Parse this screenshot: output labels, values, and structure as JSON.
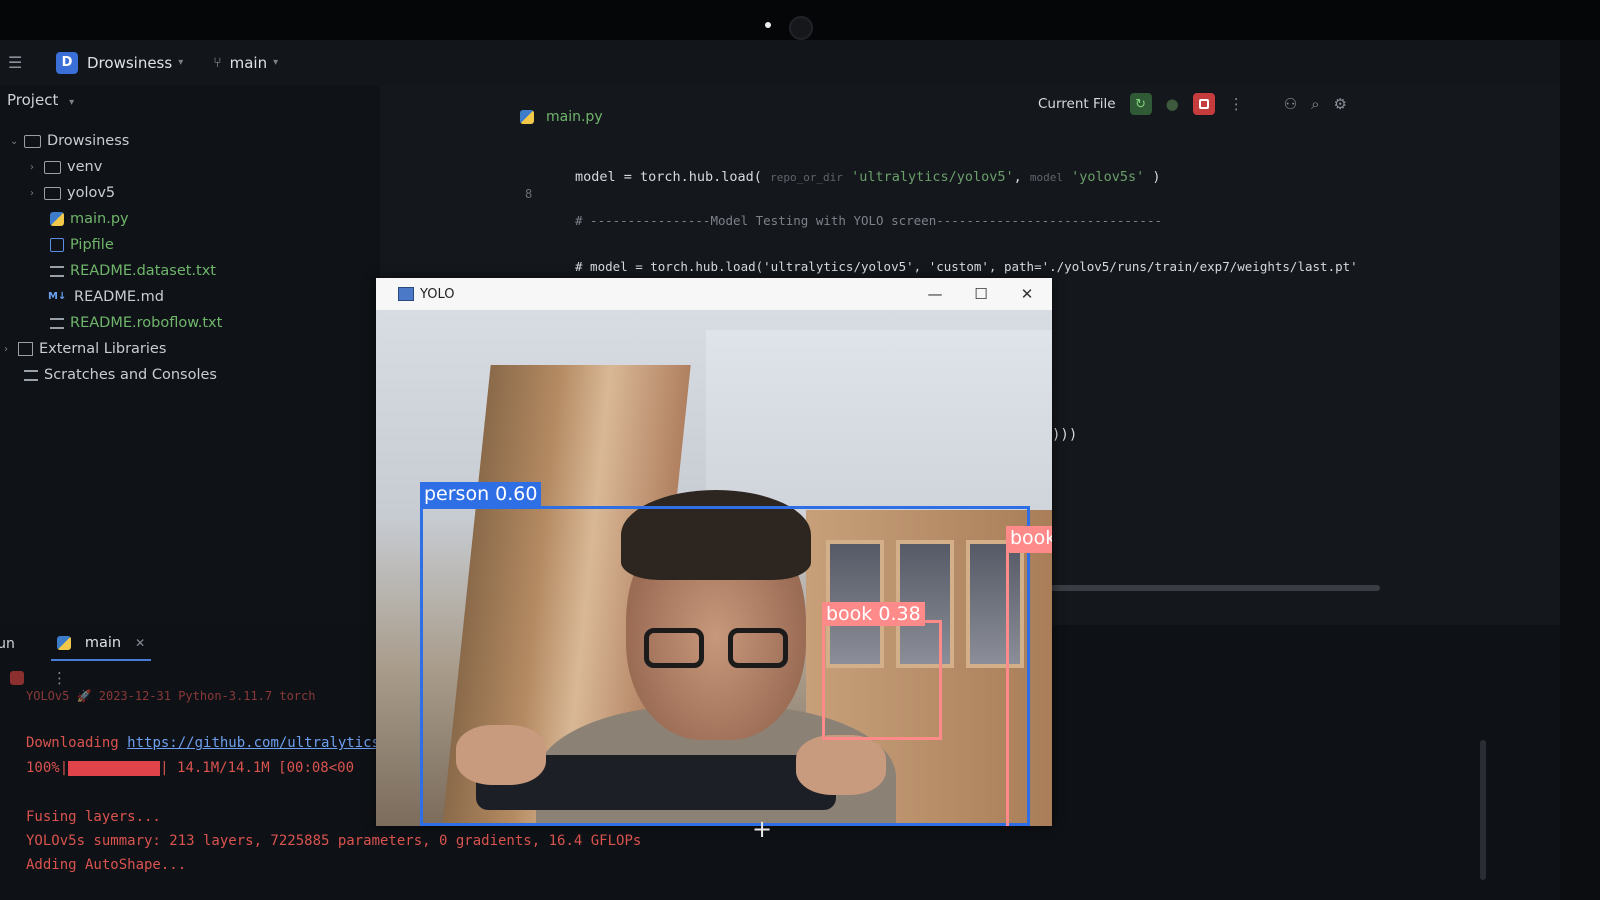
{
  "topbar": {
    "project_initial": "D",
    "project_name": "Drowsiness",
    "branch": "main"
  },
  "sidebar": {
    "header": "Project",
    "items": [
      {
        "label": "Drowsiness"
      },
      {
        "label": "venv"
      },
      {
        "label": "yolov5"
      },
      {
        "label": "main.py"
      },
      {
        "label": "Pipfile"
      },
      {
        "label": "README.dataset.txt"
      },
      {
        "label": "README.md"
      },
      {
        "label": "README.roboflow.txt"
      },
      {
        "label": "External Libraries"
      },
      {
        "label": "Scratches and Consoles"
      }
    ]
  },
  "editor": {
    "tab": "main.py",
    "run_config": "Current File",
    "line_number": "8",
    "code": {
      "line1_pre": "model = torch.hub.load( ",
      "line1_hint1": "repo_or_dir",
      "line1_str1": " 'ultralytics/yolov5'",
      "line1_sep": ", ",
      "line1_hint2": "model",
      "line1_str2": " 'yolov5s'",
      "line1_end": " )",
      "line2": "# ----------------Model Testing with YOLO screen------------------------------",
      "line3": "# model = torch.hub.load('ultralytics/yolov5', 'custom', path='./yolov5/runs/train/exp7/weights/last.pt'",
      "trail": ")))"
    }
  },
  "yolo_window": {
    "title": "YOLO",
    "minimize": "—",
    "maximize": "☐",
    "close": "✕",
    "detections": [
      {
        "label": "person 0.60",
        "color": "#2f6fe6"
      },
      {
        "label": "book 0.38",
        "color": "#ff8a8a"
      },
      {
        "label": "book",
        "color": "#ff8a8a"
      }
    ]
  },
  "run_panel": {
    "label": "Run",
    "tab": "main",
    "tab_close": "✕",
    "lines": {
      "header": "YOLOv5 🚀 2023-12-31 Python-3.11.7 torch",
      "download_prefix": "Downloading ",
      "download_link": "https://github.com/ultralytics",
      "progress_pct": "100%|",
      "progress_rest": "| 14.1M/14.1M [00:08<00",
      "fusing": "Fusing layers...",
      "summary": "YOLOv5s summary: 213 layers, 7225885 parameters, 0 gradients, 16.4 GFLOPs",
      "autoshape": "Adding AutoShape..."
    }
  },
  "colors": {
    "accent": "#3a6fd8",
    "console_red": "#d9534f",
    "run_green": "#2f5a35",
    "stop_red": "#c63b3b"
  }
}
